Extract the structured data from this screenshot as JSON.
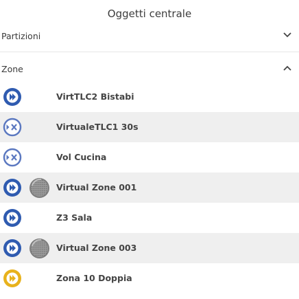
{
  "header": {
    "title": "Oggetti centrale"
  },
  "sections": {
    "partitions": {
      "label": "Partizioni",
      "expanded": false
    },
    "zones": {
      "label": "Zone",
      "expanded": true
    }
  },
  "zones": [
    {
      "name": "VirtTLC2 Bistabi",
      "status_icon": "play-circle-icon",
      "status_color": "#2f5bb0",
      "has_sensor": false
    },
    {
      "name": "VirtualeTLC1 30s",
      "status_icon": "bypass-circle-icon",
      "status_color": "#5b78c0",
      "has_sensor": false
    },
    {
      "name": "Vol Cucina",
      "status_icon": "bypass-circle-icon",
      "status_color": "#5b78c0",
      "has_sensor": false
    },
    {
      "name": "Virtual Zone 001",
      "status_icon": "play-circle-icon",
      "status_color": "#2f5bb0",
      "has_sensor": true
    },
    {
      "name": "Z3 Sala",
      "status_icon": "play-circle-icon",
      "status_color": "#2f5bb0",
      "has_sensor": false
    },
    {
      "name": "Virtual Zone 003",
      "status_icon": "play-circle-icon",
      "status_color": "#2f5bb0",
      "has_sensor": true
    },
    {
      "name": "Zona 10 Doppia",
      "status_icon": "play-circle-icon",
      "status_color": "#e8b21c",
      "has_sensor": false
    }
  ],
  "colors": {
    "play_blue": "#2f5bb0",
    "bypass_blue": "#5b78c0",
    "alert_yellow": "#e8b21c",
    "row_alt_bg": "#efefef"
  }
}
